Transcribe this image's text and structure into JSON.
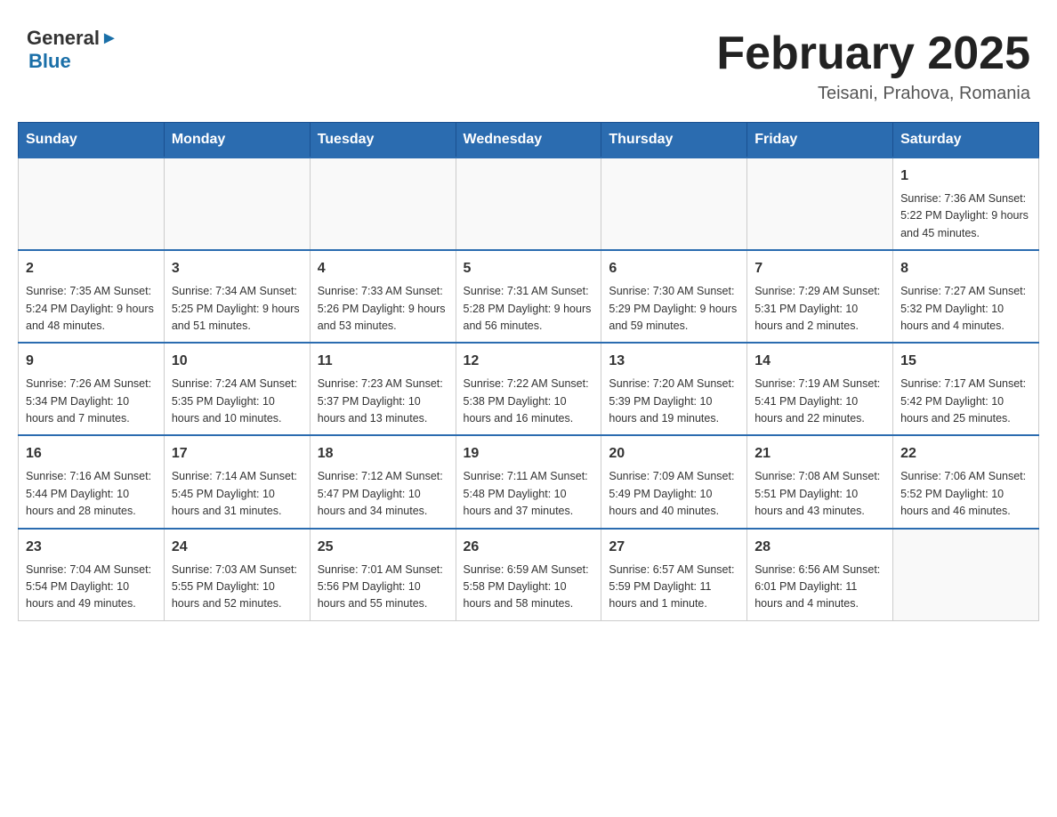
{
  "logo": {
    "general": "General",
    "arrow": "▶",
    "blue": "Blue"
  },
  "header": {
    "month_year": "February 2025",
    "location": "Teisani, Prahova, Romania"
  },
  "days_of_week": [
    "Sunday",
    "Monday",
    "Tuesday",
    "Wednesday",
    "Thursday",
    "Friday",
    "Saturday"
  ],
  "weeks": [
    [
      {
        "day": "",
        "info": ""
      },
      {
        "day": "",
        "info": ""
      },
      {
        "day": "",
        "info": ""
      },
      {
        "day": "",
        "info": ""
      },
      {
        "day": "",
        "info": ""
      },
      {
        "day": "",
        "info": ""
      },
      {
        "day": "1",
        "info": "Sunrise: 7:36 AM\nSunset: 5:22 PM\nDaylight: 9 hours and 45 minutes."
      }
    ],
    [
      {
        "day": "2",
        "info": "Sunrise: 7:35 AM\nSunset: 5:24 PM\nDaylight: 9 hours and 48 minutes."
      },
      {
        "day": "3",
        "info": "Sunrise: 7:34 AM\nSunset: 5:25 PM\nDaylight: 9 hours and 51 minutes."
      },
      {
        "day": "4",
        "info": "Sunrise: 7:33 AM\nSunset: 5:26 PM\nDaylight: 9 hours and 53 minutes."
      },
      {
        "day": "5",
        "info": "Sunrise: 7:31 AM\nSunset: 5:28 PM\nDaylight: 9 hours and 56 minutes."
      },
      {
        "day": "6",
        "info": "Sunrise: 7:30 AM\nSunset: 5:29 PM\nDaylight: 9 hours and 59 minutes."
      },
      {
        "day": "7",
        "info": "Sunrise: 7:29 AM\nSunset: 5:31 PM\nDaylight: 10 hours and 2 minutes."
      },
      {
        "day": "8",
        "info": "Sunrise: 7:27 AM\nSunset: 5:32 PM\nDaylight: 10 hours and 4 minutes."
      }
    ],
    [
      {
        "day": "9",
        "info": "Sunrise: 7:26 AM\nSunset: 5:34 PM\nDaylight: 10 hours and 7 minutes."
      },
      {
        "day": "10",
        "info": "Sunrise: 7:24 AM\nSunset: 5:35 PM\nDaylight: 10 hours and 10 minutes."
      },
      {
        "day": "11",
        "info": "Sunrise: 7:23 AM\nSunset: 5:37 PM\nDaylight: 10 hours and 13 minutes."
      },
      {
        "day": "12",
        "info": "Sunrise: 7:22 AM\nSunset: 5:38 PM\nDaylight: 10 hours and 16 minutes."
      },
      {
        "day": "13",
        "info": "Sunrise: 7:20 AM\nSunset: 5:39 PM\nDaylight: 10 hours and 19 minutes."
      },
      {
        "day": "14",
        "info": "Sunrise: 7:19 AM\nSunset: 5:41 PM\nDaylight: 10 hours and 22 minutes."
      },
      {
        "day": "15",
        "info": "Sunrise: 7:17 AM\nSunset: 5:42 PM\nDaylight: 10 hours and 25 minutes."
      }
    ],
    [
      {
        "day": "16",
        "info": "Sunrise: 7:16 AM\nSunset: 5:44 PM\nDaylight: 10 hours and 28 minutes."
      },
      {
        "day": "17",
        "info": "Sunrise: 7:14 AM\nSunset: 5:45 PM\nDaylight: 10 hours and 31 minutes."
      },
      {
        "day": "18",
        "info": "Sunrise: 7:12 AM\nSunset: 5:47 PM\nDaylight: 10 hours and 34 minutes."
      },
      {
        "day": "19",
        "info": "Sunrise: 7:11 AM\nSunset: 5:48 PM\nDaylight: 10 hours and 37 minutes."
      },
      {
        "day": "20",
        "info": "Sunrise: 7:09 AM\nSunset: 5:49 PM\nDaylight: 10 hours and 40 minutes."
      },
      {
        "day": "21",
        "info": "Sunrise: 7:08 AM\nSunset: 5:51 PM\nDaylight: 10 hours and 43 minutes."
      },
      {
        "day": "22",
        "info": "Sunrise: 7:06 AM\nSunset: 5:52 PM\nDaylight: 10 hours and 46 minutes."
      }
    ],
    [
      {
        "day": "23",
        "info": "Sunrise: 7:04 AM\nSunset: 5:54 PM\nDaylight: 10 hours and 49 minutes."
      },
      {
        "day": "24",
        "info": "Sunrise: 7:03 AM\nSunset: 5:55 PM\nDaylight: 10 hours and 52 minutes."
      },
      {
        "day": "25",
        "info": "Sunrise: 7:01 AM\nSunset: 5:56 PM\nDaylight: 10 hours and 55 minutes."
      },
      {
        "day": "26",
        "info": "Sunrise: 6:59 AM\nSunset: 5:58 PM\nDaylight: 10 hours and 58 minutes."
      },
      {
        "day": "27",
        "info": "Sunrise: 6:57 AM\nSunset: 5:59 PM\nDaylight: 11 hours and 1 minute."
      },
      {
        "day": "28",
        "info": "Sunrise: 6:56 AM\nSunset: 6:01 PM\nDaylight: 11 hours and 4 minutes."
      },
      {
        "day": "",
        "info": ""
      }
    ]
  ]
}
